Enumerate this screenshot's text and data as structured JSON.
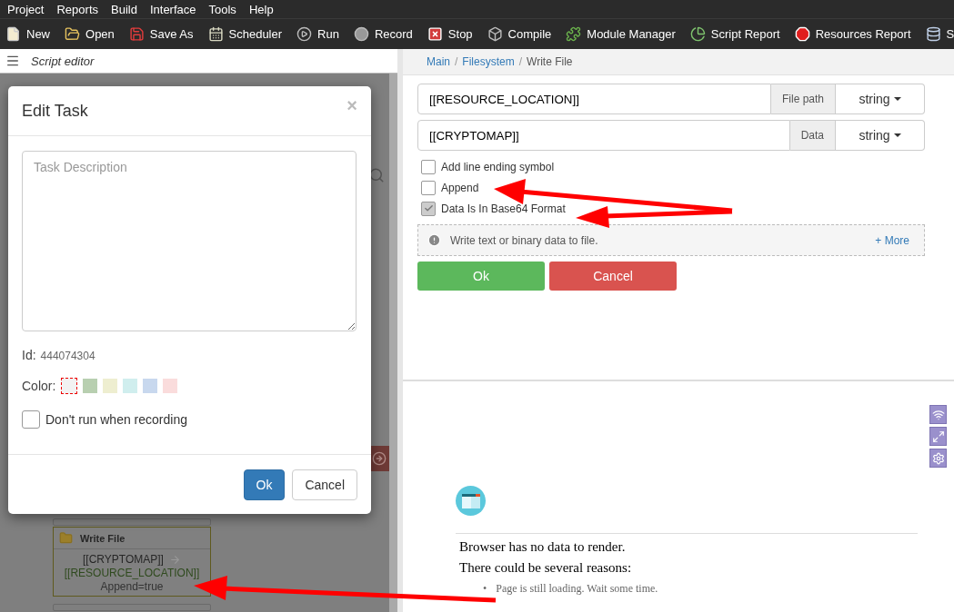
{
  "menu": [
    "Project",
    "Reports",
    "Build",
    "Interface",
    "Tools",
    "Help"
  ],
  "toolbar": [
    {
      "label": "New",
      "kind": "new"
    },
    {
      "label": "Open",
      "kind": "open"
    },
    {
      "label": "Save As",
      "kind": "save"
    },
    {
      "label": "Scheduler",
      "kind": "calendar"
    },
    {
      "label": "Run",
      "kind": "run"
    },
    {
      "label": "Record",
      "kind": "record"
    },
    {
      "label": "Stop",
      "kind": "stop"
    },
    {
      "label": "Compile",
      "kind": "compile"
    },
    {
      "label": "Module Manager",
      "kind": "module"
    },
    {
      "label": "Script Report",
      "kind": "chart"
    },
    {
      "label": "Resources Report",
      "kind": "alert"
    },
    {
      "label": "S",
      "kind": "database"
    }
  ],
  "script_editor": {
    "title": "Script editor",
    "node": {
      "title": "Write File",
      "lines": [
        {
          "text": "[[CRYPTOMAP]]",
          "kind": "input"
        },
        {
          "text": "[[RESOURCE_LOCATION]]",
          "kind": "output"
        },
        {
          "text": "Append=true",
          "kind": "param"
        }
      ]
    }
  },
  "dialog": {
    "title": "Edit Task",
    "close": "×",
    "description": {
      "placeholder": "Task Description"
    },
    "id_label": "Id:",
    "id_value": "444074304",
    "color_label": "Color:",
    "colors": [
      {
        "color": "#f2f2f2",
        "selected": true
      },
      {
        "color": "#b8cfb0",
        "selected": false
      },
      {
        "color": "#eeeed0",
        "selected": false
      },
      {
        "color": "#d0eeee",
        "selected": false
      },
      {
        "color": "#c8d8ee",
        "selected": false
      },
      {
        "color": "#fadcdc",
        "selected": false
      }
    ],
    "dont_run": {
      "label": "Don't run when recording",
      "checked": false
    },
    "buttons": [
      {
        "label": "Ok",
        "kind": "primary"
      },
      {
        "label": "Cancel",
        "kind": "default"
      }
    ]
  },
  "breadcrumb": {
    "separator": "/",
    "items": [
      {
        "label": "Main",
        "link": true
      },
      {
        "label": "Filesystem",
        "link": true
      },
      {
        "label": "Write File",
        "link": false
      }
    ]
  },
  "fields": [
    {
      "value": "[[RESOURCE_LOCATION]]",
      "label": "File path",
      "type": "string"
    },
    {
      "value": "[[CRYPTOMAP]]",
      "label": "Data",
      "type": "string"
    }
  ],
  "checkboxes": [
    {
      "label": "Add line ending symbol",
      "checked": false
    },
    {
      "label": "Append",
      "checked": false
    },
    {
      "label": "Data Is In Base64 Format",
      "checked": true
    }
  ],
  "info": {
    "text": "Write text or binary data to file.",
    "more": "+ More"
  },
  "actions": [
    {
      "label": "Ok",
      "kind": "success"
    },
    {
      "label": "Cancel",
      "kind": "danger"
    }
  ],
  "browser": {
    "message": "Browser has no data to render.",
    "reasons_title": "There could be several reasons:",
    "marker": "•",
    "reasons": [
      "Page is still loading. Wait some time."
    ]
  }
}
